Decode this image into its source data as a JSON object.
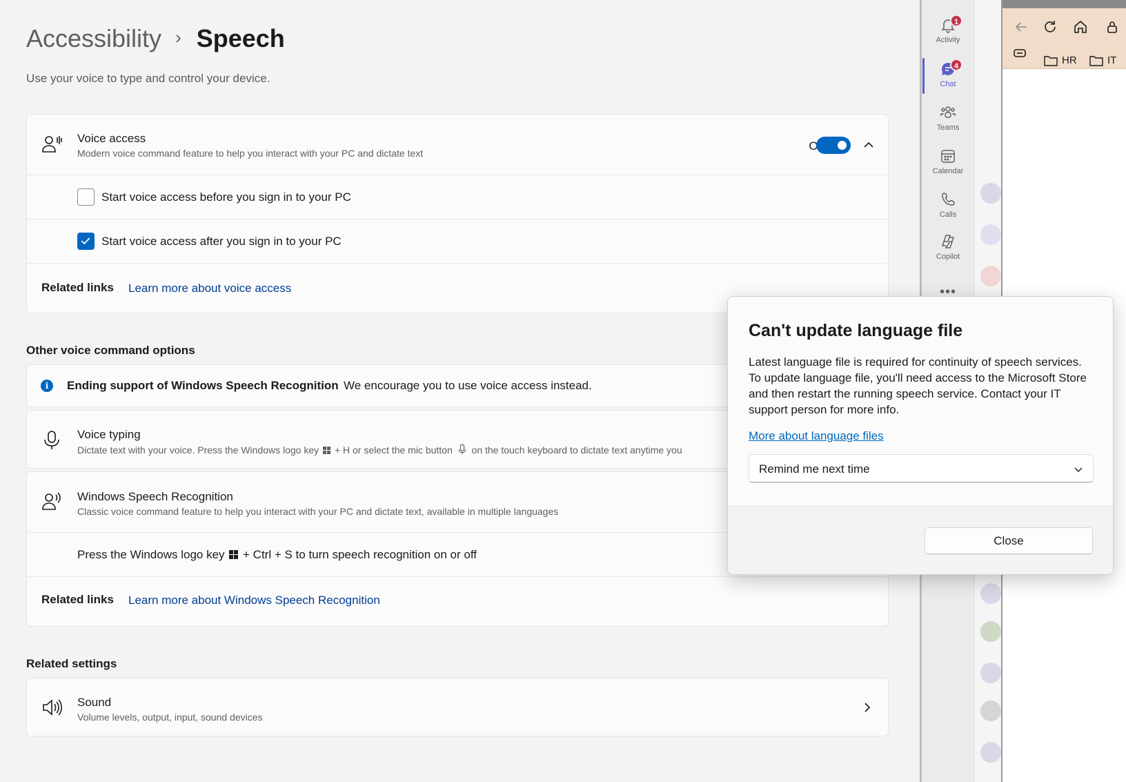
{
  "breadcrumb": {
    "parent": "Accessibility",
    "separator": "›",
    "current": "Speech"
  },
  "page_description": "Use your voice to type and control your device.",
  "voice_access": {
    "title": "Voice access",
    "subtitle": "Modern voice command feature to help you interact with your PC and dictate text",
    "toggle_label": "On",
    "toggle_on": true,
    "before_signin_label": "Start voice access before you sign in to your PC",
    "before_signin_checked": false,
    "after_signin_label": "Start voice access after you sign in to your PC",
    "after_signin_checked": true,
    "related_links_label": "Related links",
    "related_link": "Learn more about voice access"
  },
  "other_options": {
    "heading": "Other voice command options",
    "info_title": "Ending support of Windows Speech Recognition",
    "info_text": "We encourage you to use voice access instead.",
    "voice_typing_title": "Voice typing",
    "voice_typing_sub_1": "Dictate text with your voice. Press the Windows logo key",
    "voice_typing_sub_2": "+ H or select the mic button",
    "voice_typing_sub_3": "on the touch keyboard to dictate text anytime you",
    "wsr_title": "Windows Speech Recognition",
    "wsr_sub": "Classic voice command feature to help you interact with your PC and dictate text, available in multiple languages",
    "wsr_shortcut_1": "Press the Windows logo key",
    "wsr_shortcut_2": "+ Ctrl + S to turn speech recognition on or off",
    "related_links_label": "Related links",
    "related_link": "Learn more about Windows Speech Recognition"
  },
  "related_settings": {
    "heading": "Related settings",
    "sound_title": "Sound",
    "sound_sub": "Volume levels, output, input, sound devices"
  },
  "teams_rail": {
    "items": [
      {
        "label": "Activity",
        "badge": "1",
        "icon": "bell-icon"
      },
      {
        "label": "Chat",
        "badge": "4",
        "icon": "chat-icon"
      },
      {
        "label": "Teams",
        "badge": "",
        "icon": "teams-icon"
      },
      {
        "label": "Calendar",
        "badge": "",
        "icon": "calendar-icon"
      },
      {
        "label": "Calls",
        "badge": "",
        "icon": "phone-icon"
      },
      {
        "label": "Copilot",
        "badge": "",
        "icon": "copilot-icon"
      }
    ],
    "more": "•••"
  },
  "browser": {
    "favorites": [
      {
        "label": "HR",
        "icon": "folder-icon"
      },
      {
        "label": "IT",
        "icon": "folder-icon"
      }
    ]
  },
  "dialog": {
    "title": "Can't update language file",
    "body": "Latest language file is required for continuity of speech services. To update language file, you'll need access to the Microsoft Store and then restart the running speech service. Contact your IT support person for more info.",
    "link": "More about language files",
    "select_value": "Remind me next time",
    "close_button": "Close"
  },
  "colors": {
    "accent": "#0067c0",
    "teams_accent": "#5b5fc7",
    "badge": "#c4314b",
    "link": "#003e92"
  }
}
